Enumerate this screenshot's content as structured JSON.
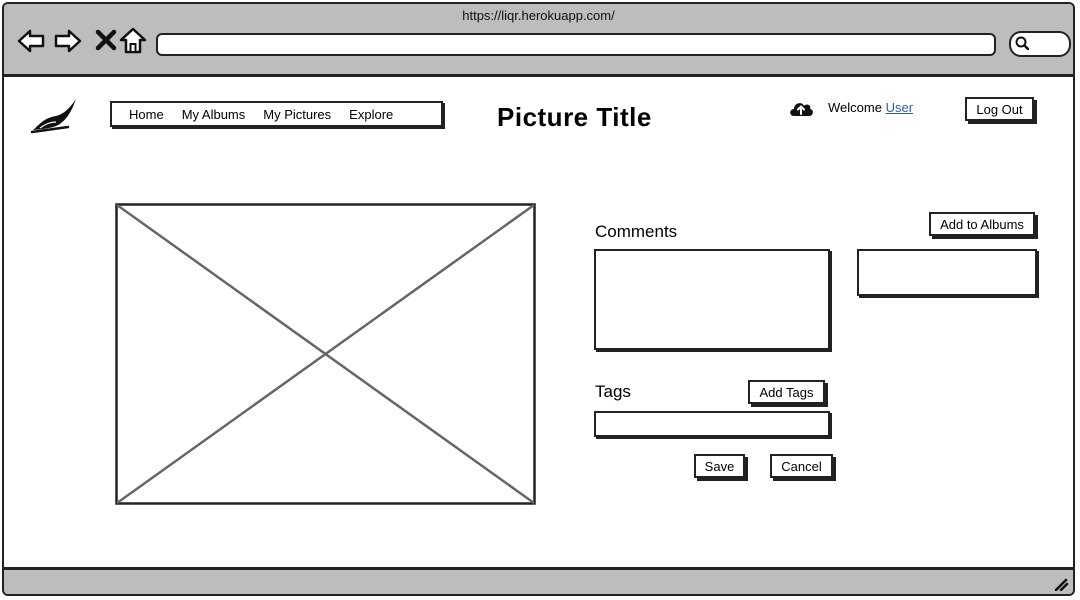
{
  "browser": {
    "url": "https://liqr.herokuapp.com/"
  },
  "nav": {
    "items": [
      "Home",
      "My Albums",
      "My Pictures",
      "Explore"
    ]
  },
  "header": {
    "title": "Picture Title",
    "welcome_prefix": "Welcome",
    "user_link": "User",
    "logout_label": "Log Out"
  },
  "comments": {
    "label": "Comments",
    "value": ""
  },
  "albums": {
    "add_label": "Add to Albums",
    "value": ""
  },
  "tags": {
    "label": "Tags",
    "add_label": "Add Tags",
    "value": ""
  },
  "actions": {
    "save_label": "Save",
    "cancel_label": "Cancel"
  },
  "icons": {
    "back": "back-arrow-icon",
    "forward": "forward-arrow-icon",
    "stop": "close-icon",
    "home": "home-icon",
    "search": "search-icon",
    "logo": "feather-logo-icon",
    "upload": "cloud-upload-icon",
    "resize": "resize-grip-icon",
    "image": "image-placeholder-icon"
  }
}
